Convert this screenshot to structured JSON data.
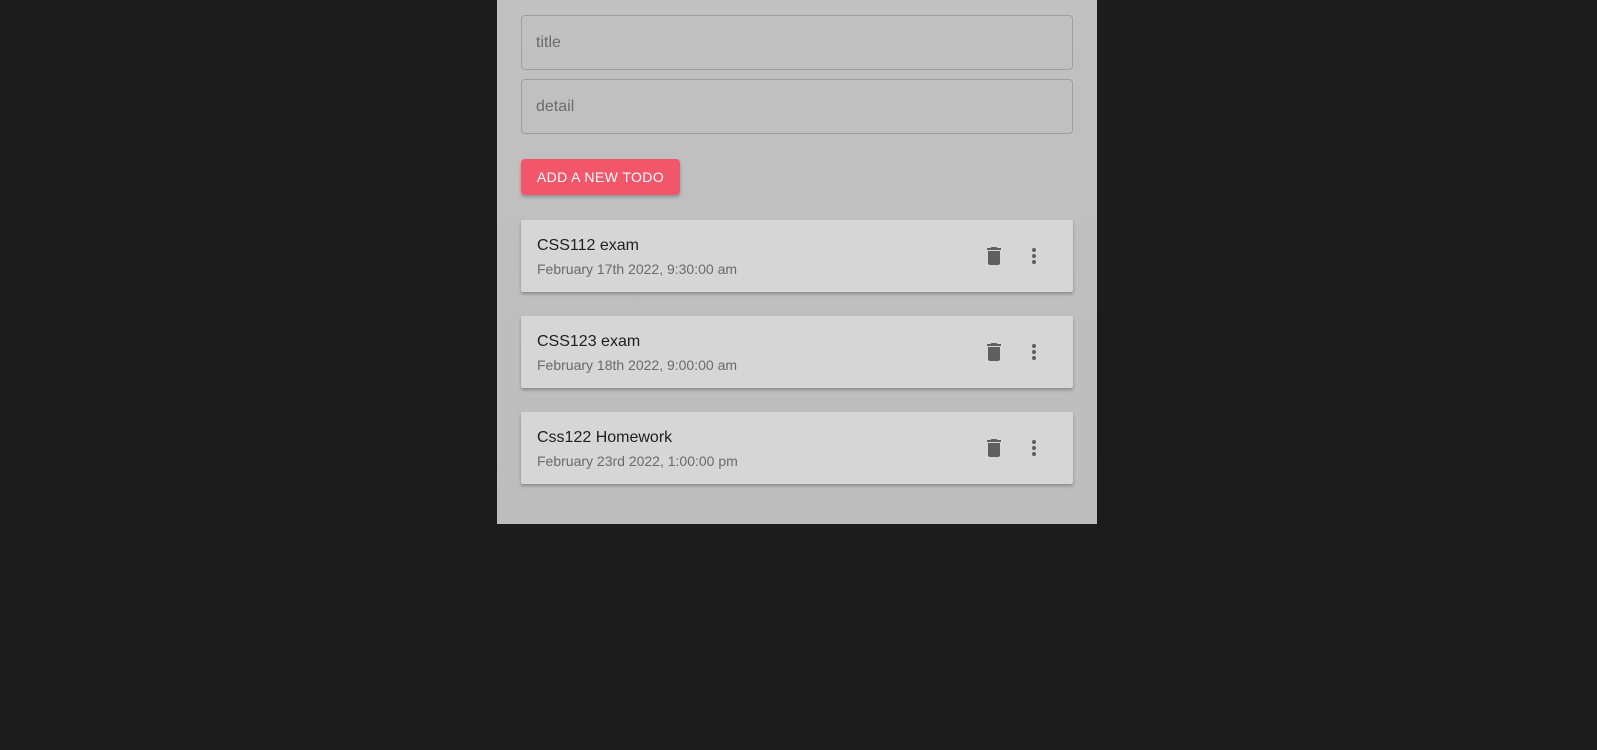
{
  "form": {
    "title_placeholder": "title",
    "detail_placeholder": "detail",
    "title_value": "",
    "detail_value": "",
    "add_button_label": "ADD A NEW TODO"
  },
  "todos": [
    {
      "title": "CSS112 exam",
      "datetime": "February 17th 2022, 9:30:00 am"
    },
    {
      "title": "CSS123 exam",
      "datetime": "February 18th 2022, 9:00:00 am"
    },
    {
      "title": "Css122 Homework",
      "datetime": "February 23rd 2022, 1:00:00 pm"
    }
  ],
  "icons": {
    "delete": "trash-icon",
    "more": "more-vert-icon"
  },
  "colors": {
    "page_background": "#1c1c1c",
    "panel_background": "#c0c0c0",
    "card_background": "#d6d6d6",
    "accent": "#f2566b",
    "icon": "#5f5f5f"
  }
}
